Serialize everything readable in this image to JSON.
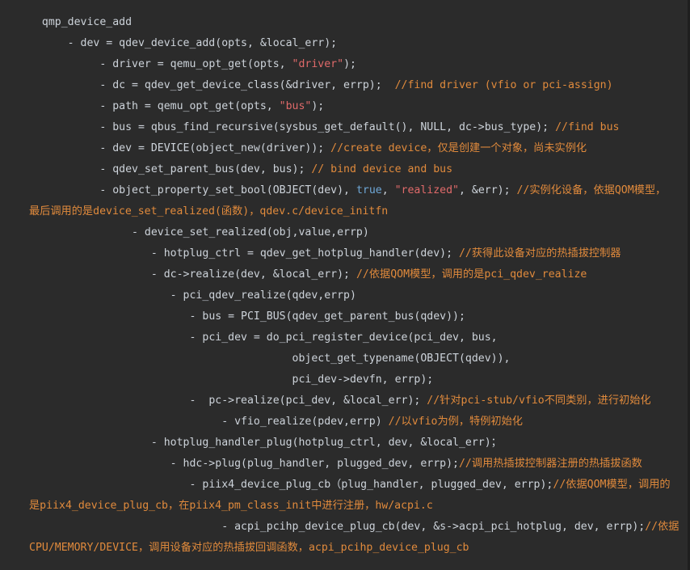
{
  "code": {
    "lines": [
      {
        "indent": "  ",
        "parts": [
          {
            "t": "p",
            "v": "qmp_device_add"
          }
        ]
      },
      {
        "indent": "      ",
        "parts": [
          {
            "t": "p",
            "v": "- dev = qdev_device_add(opts, &local_err);"
          }
        ]
      },
      {
        "indent": "           ",
        "parts": [
          {
            "t": "p",
            "v": "- driver = qemu_opt_get(opts, "
          },
          {
            "t": "s",
            "v": "\"driver\""
          },
          {
            "t": "p",
            "v": ");"
          }
        ]
      },
      {
        "indent": "           ",
        "parts": [
          {
            "t": "p",
            "v": "- dc = qdev_get_device_class(&driver, errp);  "
          },
          {
            "t": "c",
            "v": "//find driver (vfio or pci-assign)"
          }
        ]
      },
      {
        "indent": "           ",
        "parts": [
          {
            "t": "p",
            "v": "- path = qemu_opt_get(opts, "
          },
          {
            "t": "s",
            "v": "\"bus\""
          },
          {
            "t": "p",
            "v": ");"
          }
        ]
      },
      {
        "indent": "           ",
        "parts": [
          {
            "t": "p",
            "v": "- bus = qbus_find_recursive(sysbus_get_default(), NULL, dc->bus_type); "
          },
          {
            "t": "c",
            "v": "//find bus"
          }
        ]
      },
      {
        "indent": "           ",
        "parts": [
          {
            "t": "p",
            "v": "- dev = DEVICE(object_new(driver)); "
          },
          {
            "t": "c",
            "v": "//create device，仅是创建一个对象，尚未实例化"
          }
        ]
      },
      {
        "indent": "           ",
        "parts": [
          {
            "t": "p",
            "v": "- qdev_set_parent_bus(dev, bus); "
          },
          {
            "t": "c",
            "v": "// bind device and bus"
          }
        ]
      },
      {
        "indent": "           ",
        "parts": [
          {
            "t": "p",
            "v": "- object_property_set_bool(OBJECT(dev), "
          },
          {
            "t": "k",
            "v": "true"
          },
          {
            "t": "p",
            "v": ", "
          },
          {
            "t": "s",
            "v": "\"realized\""
          },
          {
            "t": "p",
            "v": ", &err); "
          },
          {
            "t": "c",
            "v": "//实例化设备，依据QOM模型，"
          }
        ]
      },
      {
        "indent": "",
        "parts": [
          {
            "t": "c",
            "v": "最后调用的是device_set_realized(函数)，qdev.c/device_initfn"
          }
        ]
      },
      {
        "indent": "                ",
        "parts": [
          {
            "t": "p",
            "v": "- device_set_realized(obj,value,errp)"
          }
        ]
      },
      {
        "indent": "                   ",
        "parts": [
          {
            "t": "p",
            "v": "- hotplug_ctrl = qdev_get_hotplug_handler(dev); "
          },
          {
            "t": "c",
            "v": "//获得此设备对应的热插拔控制器"
          }
        ]
      },
      {
        "indent": "                   ",
        "parts": [
          {
            "t": "p",
            "v": "- dc->realize(dev, &local_err); "
          },
          {
            "t": "c",
            "v": "//依据QOM模型，调用的是pci_qdev_realize"
          }
        ]
      },
      {
        "indent": "                      ",
        "parts": [
          {
            "t": "p",
            "v": "- pci_qdev_realize(qdev,errp)"
          }
        ]
      },
      {
        "indent": "                         ",
        "parts": [
          {
            "t": "p",
            "v": "- bus = PCI_BUS(qdev_get_parent_bus(qdev));"
          }
        ]
      },
      {
        "indent": "                         ",
        "parts": [
          {
            "t": "p",
            "v": "- pci_dev = do_pci_register_device(pci_dev, bus,"
          }
        ]
      },
      {
        "indent": "                                         ",
        "parts": [
          {
            "t": "p",
            "v": "object_get_typename(OBJECT(qdev)),"
          }
        ]
      },
      {
        "indent": "                                         ",
        "parts": [
          {
            "t": "p",
            "v": "pci_dev->devfn, errp);"
          }
        ]
      },
      {
        "indent": "                         ",
        "parts": [
          {
            "t": "p",
            "v": "-  pc->realize(pci_dev, &local_err); "
          },
          {
            "t": "c",
            "v": "//针对pci-stub/vfio不同类别，进行初始化"
          }
        ]
      },
      {
        "indent": "                              ",
        "parts": [
          {
            "t": "p",
            "v": "- vfio_realize(pdev,errp) "
          },
          {
            "t": "c",
            "v": "//以vfio为例，特例初始化"
          }
        ]
      },
      {
        "indent": "                   ",
        "parts": [
          {
            "t": "p",
            "v": "- hotplug_handler_plug(hotplug_ctrl, dev, &local_err)；"
          }
        ]
      },
      {
        "indent": "                      ",
        "parts": [
          {
            "t": "p",
            "v": "- hdc->plug(plug_handler, plugged_dev, errp);"
          },
          {
            "t": "c",
            "v": "//调用热插拔控制器注册的热插拔函数"
          }
        ]
      },
      {
        "indent": "                         ",
        "parts": [
          {
            "t": "p",
            "v": "- piix4_device_plug_cb（plug_handler, plugged_dev, errp);"
          },
          {
            "t": "c",
            "v": "//依据QOM模型，调用的"
          }
        ]
      },
      {
        "indent": "",
        "parts": [
          {
            "t": "c",
            "v": "是piix4_device_plug_cb，在piix4_pm_class_init中进行注册，hw/acpi.c"
          }
        ]
      },
      {
        "indent": "                              ",
        "parts": [
          {
            "t": "p",
            "v": "- acpi_pcihp_device_plug_cb(dev, &s->acpi_pci_hotplug, dev, errp);"
          },
          {
            "t": "c",
            "v": "//依据"
          }
        ]
      },
      {
        "indent": "",
        "parts": [
          {
            "t": "c",
            "v": "CPU/MEMORY/DEVICE，调用设备对应的热插拔回调函数，acpi_pcihp_device_plug_cb"
          }
        ]
      }
    ]
  }
}
